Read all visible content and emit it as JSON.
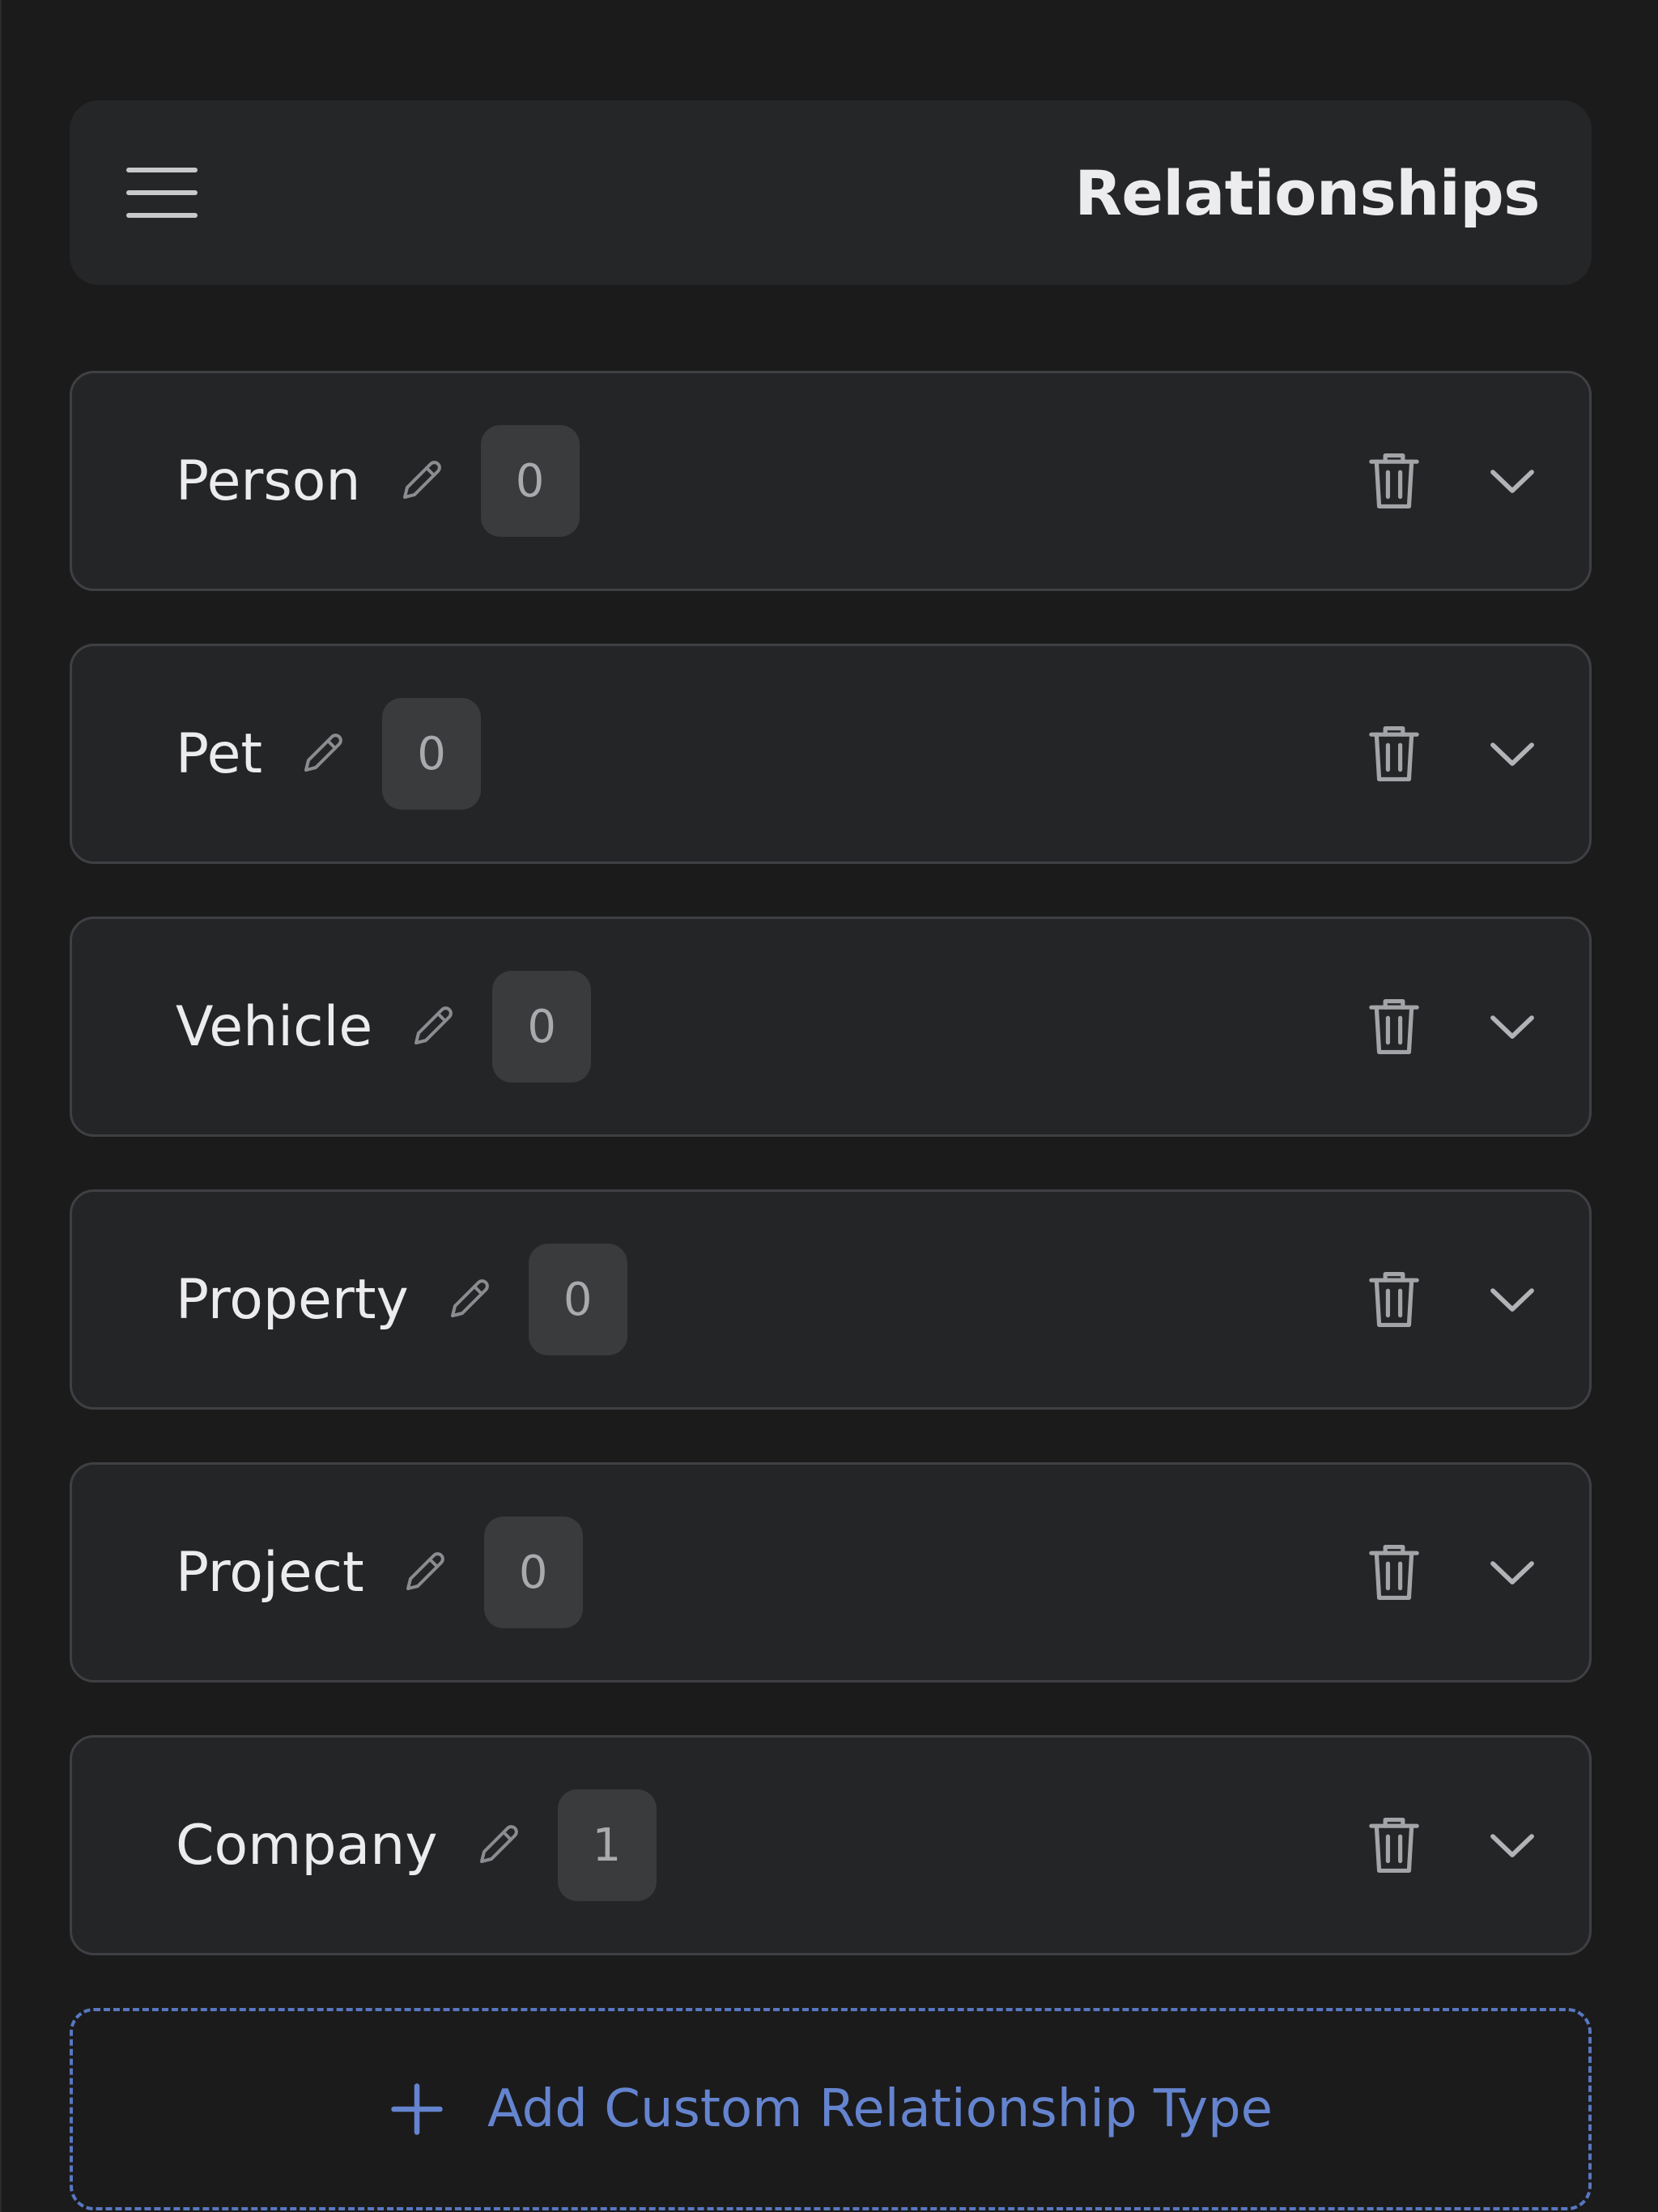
{
  "header": {
    "title": "Relationships",
    "menu_icon": "hamburger-menu-icon"
  },
  "relationship_types": [
    {
      "name": "Person",
      "count": "0"
    },
    {
      "name": "Pet",
      "count": "0"
    },
    {
      "name": "Vehicle",
      "count": "0"
    },
    {
      "name": "Property",
      "count": "0"
    },
    {
      "name": "Project",
      "count": "0"
    },
    {
      "name": "Company",
      "count": "1"
    }
  ],
  "icons": {
    "edit": "pencil-icon",
    "delete": "trash-icon",
    "expand": "chevron-down-icon",
    "add": "plus-icon"
  },
  "add_button": {
    "label": "Add Custom Relationship Type"
  },
  "colors": {
    "background": "#1b1b1c",
    "card": "#242527",
    "accent": "#6584cf"
  }
}
